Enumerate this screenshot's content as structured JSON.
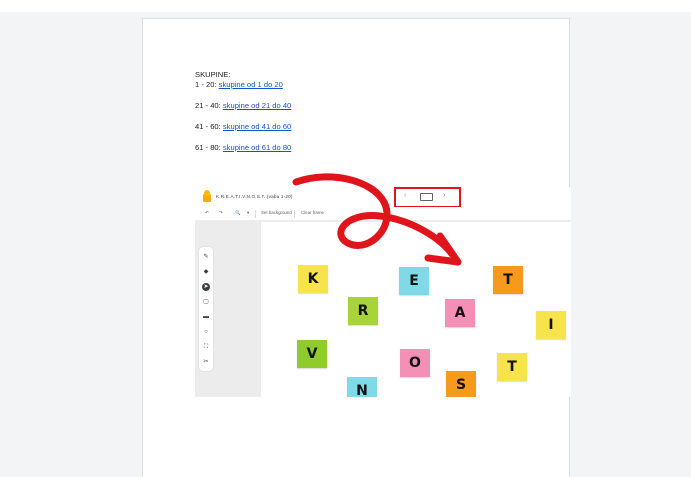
{
  "groups": {
    "heading": "SKUPINE:",
    "rows": [
      {
        "range": "1 - 20: ",
        "link": "skupine od 1 do 20"
      },
      {
        "range": "21 - 40: ",
        "link": "skupine od 21 do 40"
      },
      {
        "range": "41 - 60: ",
        "link": "skupine od 41 do 60"
      },
      {
        "range": "61 - 80: ",
        "link": "skupine od 61 do 80"
      }
    ]
  },
  "screenshot": {
    "board_title": "K.R.E.A.T.I.V.N.O.S.T. (vaba 1-20)",
    "nav": {
      "prev": "‹",
      "next": "›"
    },
    "toolbar": {
      "undo": "↶",
      "redo": "↷",
      "zoom": "🔍",
      "zoom_caret": "▾",
      "set_background": "Set background",
      "clear_frame": "Clear frame"
    },
    "tools": [
      "✎",
      "◆",
      "➤",
      "▢",
      "▬",
      "○",
      "⛶",
      "✂"
    ]
  },
  "notes": [
    {
      "letter": "K",
      "color": "#f7e34a"
    },
    {
      "letter": "E",
      "color": "#7fd9e6"
    },
    {
      "letter": "T",
      "color": "#f59a1b"
    },
    {
      "letter": "R",
      "color": "#a8d43a"
    },
    {
      "letter": "A",
      "color": "#f58fb6"
    },
    {
      "letter": "I",
      "color": "#f7e34a"
    },
    {
      "letter": "V",
      "color": "#8fcb2a"
    },
    {
      "letter": "O",
      "color": "#f58fb6"
    },
    {
      "letter": "T",
      "color": "#f7e34a"
    },
    {
      "letter": "N",
      "color": "#7fd9e6"
    },
    {
      "letter": "S",
      "color": "#f59a1b"
    }
  ],
  "accent": {
    "highlight_red": "#e0151b",
    "link_blue": "#1155cc"
  }
}
